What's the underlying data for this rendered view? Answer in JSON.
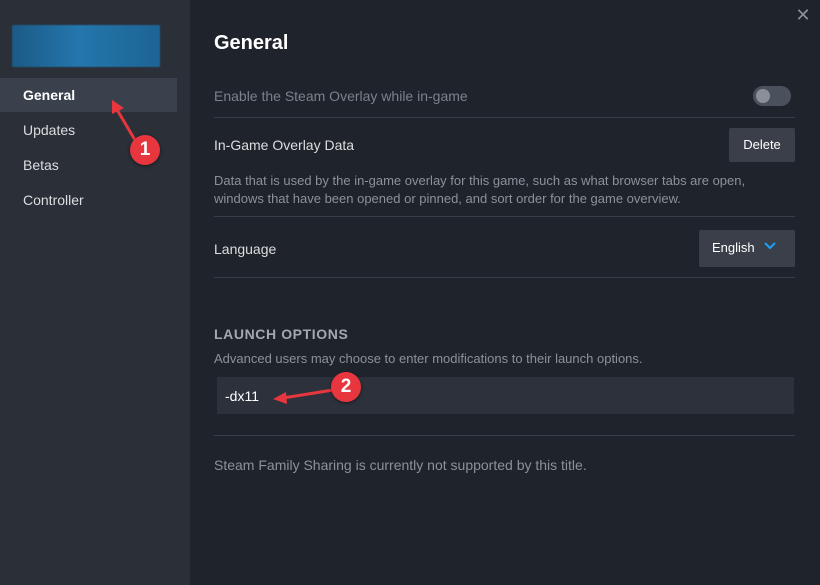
{
  "sidebar": {
    "items": [
      {
        "label": "General",
        "active": true
      },
      {
        "label": "Updates",
        "active": false
      },
      {
        "label": "Betas",
        "active": false
      },
      {
        "label": "Controller",
        "active": false
      }
    ]
  },
  "window": {
    "close_icon": "close-icon"
  },
  "main": {
    "title": "General",
    "overlay_toggle": {
      "label": "Enable the Steam Overlay while in-game",
      "enabled": false
    },
    "overlay_data": {
      "label": "In-Game Overlay Data",
      "button": "Delete",
      "description": "Data that is used by the in-game overlay for this game, such as what browser tabs are open, windows that have been opened or pinned, and sort order for the game overview."
    },
    "language": {
      "label": "Language",
      "selected": "English"
    },
    "launch_options": {
      "header": "LAUNCH OPTIONS",
      "description": "Advanced users may choose to enter modifications to their launch options.",
      "value": "-dx11"
    },
    "family_sharing": "Steam Family Sharing is currently not supported by this title."
  },
  "annotations": [
    {
      "label": "1"
    },
    {
      "label": "2"
    }
  ],
  "colors": {
    "accent": "#1a9fff",
    "annotation": "#e8363f"
  }
}
